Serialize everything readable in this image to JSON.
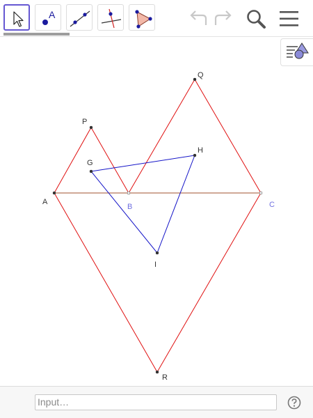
{
  "toolbar": {
    "tools": [
      {
        "name": "Move",
        "active": true
      },
      {
        "name": "Point",
        "label": "A"
      },
      {
        "name": "Line"
      },
      {
        "name": "Perpendicular Line"
      },
      {
        "name": "Polygon"
      }
    ],
    "actions": [
      "undo-icon",
      "redo-icon",
      "search-icon",
      "menu-icon"
    ]
  },
  "graphics": {
    "points": {
      "A": {
        "label": "A",
        "color": "#333333"
      },
      "B": {
        "label": "B",
        "color": "#7070e0"
      },
      "C": {
        "label": "C",
        "color": "#7070e0"
      },
      "P": {
        "label": "P",
        "color": "#333333"
      },
      "Q": {
        "label": "Q",
        "color": "#333333"
      },
      "R": {
        "label": "R",
        "color": "#333333"
      },
      "G": {
        "label": "G",
        "color": "#333333"
      },
      "H": {
        "label": "H",
        "color": "#333333"
      },
      "I": {
        "label": "I",
        "color": "#333333"
      }
    },
    "colors": {
      "red": "#e01010",
      "blue": "#1515c8",
      "brown": "#a0522d"
    }
  },
  "input_bar": {
    "placeholder": "Input…"
  }
}
